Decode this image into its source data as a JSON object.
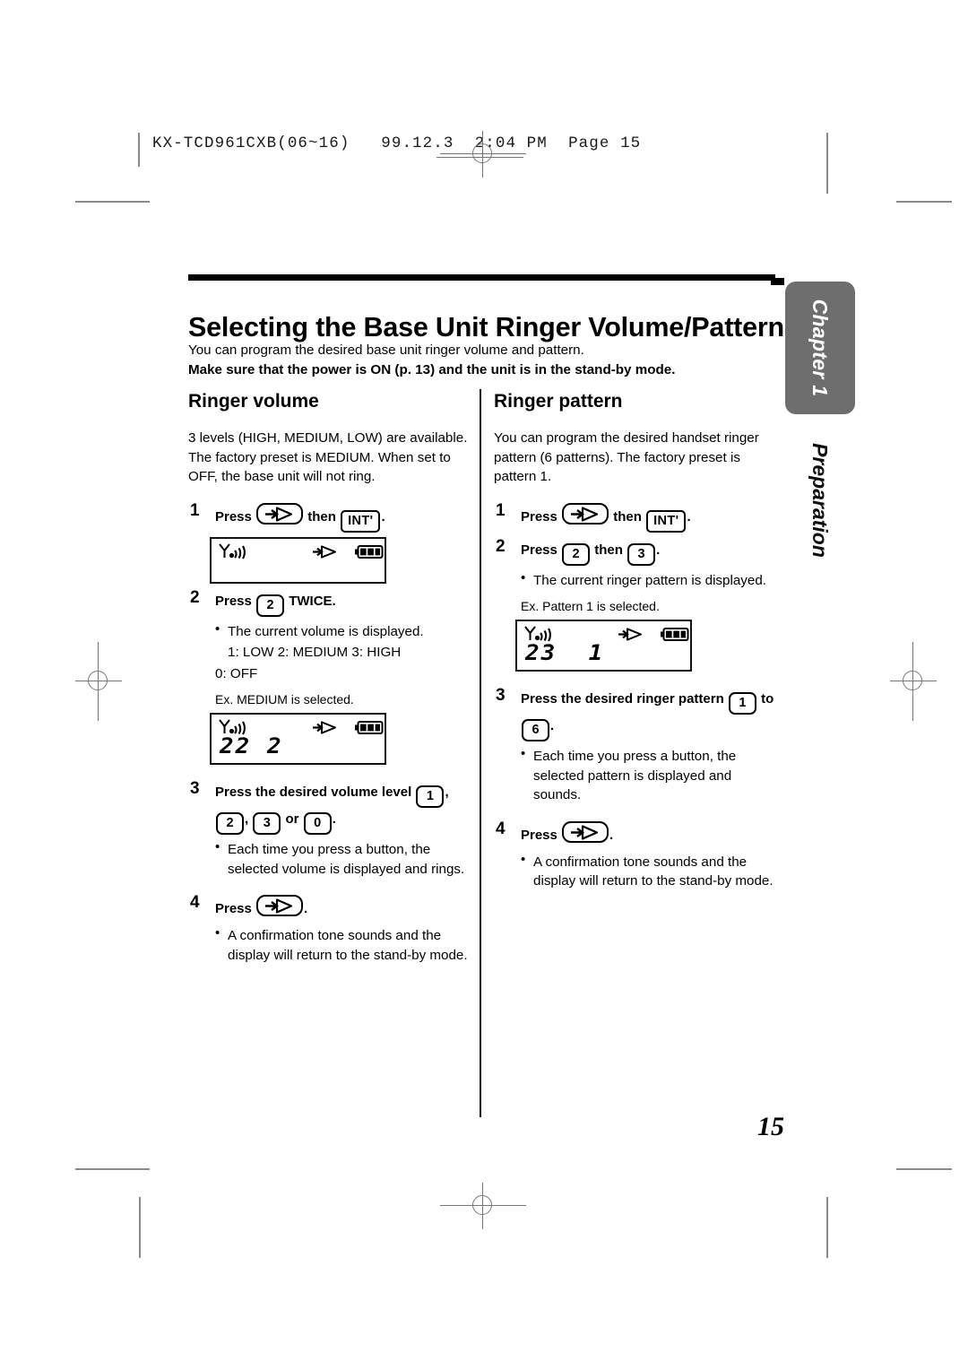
{
  "print_slug": "KX-TCD961CXB(06~16)   99.12.3  2:04 PM  Page 15",
  "page_number": "15",
  "chapter_tab": {
    "label": "Chapter 1",
    "sub_label": "Preparation"
  },
  "title": "Selecting the Base Unit Ringer Volume/Pattern",
  "intro": {
    "line1": "You can program the desired base unit ringer volume and pattern.",
    "line2": "Make sure that the power is ON (p. 13) and the unit is in the stand-by mode."
  },
  "left_column": {
    "heading": "Ringer volume",
    "intro": "3 levels (HIGH, MEDIUM, LOW) are available. The factory preset is MEDIUM. When set to OFF, the base unit will not ring.",
    "step1": {
      "num": "1",
      "press": "Press",
      "key_arrow": "arrow-key-icon",
      "then": "then",
      "key_int": "INT'",
      "period": "."
    },
    "lcd1": {
      "antenna": "antenna-signal-icon",
      "arrow": "arrow-icon",
      "battery": "battery-full-icon",
      "digits": ""
    },
    "step2": {
      "num": "2",
      "press": "Press",
      "key": "2",
      "suffix": "TWICE."
    },
    "step2_bullet": "The current volume is displayed.",
    "levels_line1": "1: LOW   2: MEDIUM   3: HIGH",
    "levels_line2": "0: OFF",
    "example_caption": "Ex. MEDIUM is selected.",
    "lcd2": {
      "antenna": "antenna-signal-icon",
      "arrow": "arrow-icon",
      "battery": "battery-full-icon",
      "digits": "22 2"
    },
    "step3": {
      "num": "3",
      "text_before": "Press the desired volume level",
      "key1": "1",
      "key2": "2",
      "key3": "3",
      "or": "or",
      "key0": "0",
      "period": "."
    },
    "step3_bullet": "Each time you press a button, the selected volume is displayed and rings.",
    "step4": {
      "num": "4",
      "press": "Press",
      "key_arrow": "arrow-key-icon",
      "period": "."
    },
    "step4_bullet": "A confirmation tone sounds and the display will return to the stand-by mode."
  },
  "right_column": {
    "heading": "Ringer pattern",
    "intro": "You can program the desired handset ringer pattern (6 patterns). The factory preset is pattern 1.",
    "step1": {
      "num": "1",
      "press": "Press",
      "key_arrow": "arrow-key-icon",
      "then": "then",
      "key_int": "INT'",
      "period": "."
    },
    "step2": {
      "num": "2",
      "press": "Press",
      "key_a": "2",
      "then": "then",
      "key_b": "3",
      "period": "."
    },
    "step2_bullet": "The current ringer pattern is displayed.",
    "example_caption": "Ex. Pattern 1 is selected.",
    "lcd1": {
      "antenna": "antenna-signal-icon",
      "arrow": "arrow-icon",
      "battery": "battery-full-icon",
      "digits": "23  1"
    },
    "step3": {
      "num": "3",
      "text_before": "Press the desired ringer pattern",
      "key1": "1",
      "to": "to",
      "key6": "6",
      "period": "."
    },
    "step3_bullet": "Each time you press a button, the selected pattern is displayed and sounds.",
    "step4": {
      "num": "4",
      "press": "Press",
      "key_arrow": "arrow-key-icon",
      "period": "."
    },
    "step4_bullet": "A confirmation tone sounds and the display will return to the stand-by mode."
  }
}
